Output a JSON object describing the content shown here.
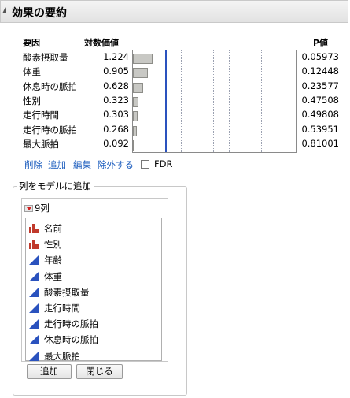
{
  "section": {
    "title": "効果の要約"
  },
  "table": {
    "headers": {
      "factor": "要因",
      "logworth": "対数価値",
      "pvalue": "P値"
    },
    "rows": [
      {
        "factor": "酸素摂取量",
        "logworth": "1.224",
        "pvalue": "0.05973",
        "logworth_num": 1.224
      },
      {
        "factor": "体重",
        "logworth": "0.905",
        "pvalue": "0.12448",
        "logworth_num": 0.905
      },
      {
        "factor": "休息時の脈拍",
        "logworth": "0.628",
        "pvalue": "0.23577",
        "logworth_num": 0.628
      },
      {
        "factor": "性別",
        "logworth": "0.323",
        "pvalue": "0.47508",
        "logworth_num": 0.323
      },
      {
        "factor": "走行時間",
        "logworth": "0.303",
        "pvalue": "0.49808",
        "logworth_num": 0.303
      },
      {
        "factor": "走行時の脈拍",
        "logworth": "0.268",
        "pvalue": "0.53951",
        "logworth_num": 0.268
      },
      {
        "factor": "最大脈拍",
        "logworth": "0.092",
        "pvalue": "0.81001",
        "logworth_num": 0.092
      }
    ],
    "threshold_logworth": 2
  },
  "actions": {
    "remove": "削除",
    "add": "追加",
    "edit": "編集",
    "exclude": "除外する",
    "fdr_label": "FDR",
    "fdr_checked": false
  },
  "add_panel": {
    "title": "列をモデルに追加",
    "count_label": "9列",
    "columns": [
      {
        "name": "名前",
        "icon": "nominal-bar-icon"
      },
      {
        "name": "性別",
        "icon": "nominal-bar-icon"
      },
      {
        "name": "年齢",
        "icon": "continuous-triangle-icon"
      },
      {
        "name": "体重",
        "icon": "continuous-triangle-icon"
      },
      {
        "name": "酸素摂取量",
        "icon": "continuous-triangle-icon"
      },
      {
        "name": "走行時間",
        "icon": "continuous-triangle-icon"
      },
      {
        "name": "走行時の脈拍",
        "icon": "continuous-triangle-icon"
      },
      {
        "name": "休息時の脈拍",
        "icon": "continuous-triangle-icon"
      },
      {
        "name": "最大脈拍",
        "icon": "continuous-triangle-icon"
      }
    ],
    "add_button": "追加",
    "close_button": "閉じる"
  },
  "colors": {
    "threshold": "#2a52be",
    "link": "#1f5fbf",
    "nominal": "#c0392b",
    "continuous": "#2a52be"
  }
}
